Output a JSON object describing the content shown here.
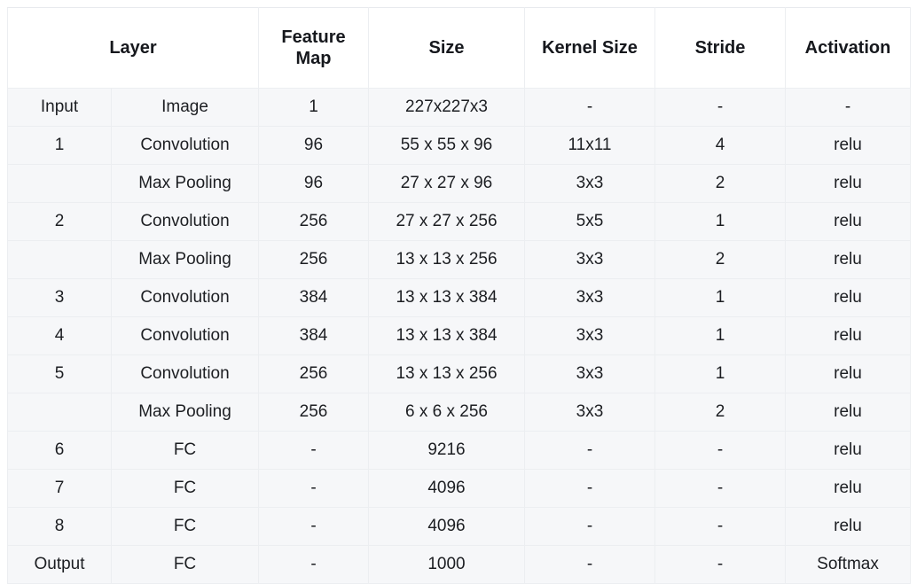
{
  "table": {
    "headers": [
      {
        "label": "Layer",
        "colspan": 2,
        "name": "header-layer"
      },
      {
        "label": "Feature Map",
        "colspan": 1,
        "name": "header-feature-map"
      },
      {
        "label": "Size",
        "colspan": 1,
        "name": "header-size"
      },
      {
        "label": "Kernel Size",
        "colspan": 1,
        "name": "header-kernel-size"
      },
      {
        "label": "Stride",
        "colspan": 1,
        "name": "header-stride"
      },
      {
        "label": "Activation",
        "colspan": 1,
        "name": "header-activation"
      }
    ],
    "column_keys": [
      "layer",
      "type",
      "feature_map",
      "size",
      "kernel_size",
      "stride",
      "activation"
    ],
    "rows": [
      {
        "layer": "Input",
        "type": "Image",
        "feature_map": "1",
        "size": "227x227x3",
        "kernel_size": "-",
        "stride": "-",
        "activation": "-"
      },
      {
        "layer": "1",
        "type": "Convolution",
        "feature_map": "96",
        "size": "55 x 55 x 96",
        "kernel_size": "11x11",
        "stride": "4",
        "activation": "relu"
      },
      {
        "layer": "",
        "type": "Max Pooling",
        "feature_map": "96",
        "size": "27 x 27 x 96",
        "kernel_size": "3x3",
        "stride": "2",
        "activation": "relu"
      },
      {
        "layer": "2",
        "type": "Convolution",
        "feature_map": "256",
        "size": "27 x 27 x 256",
        "kernel_size": "5x5",
        "stride": "1",
        "activation": "relu"
      },
      {
        "layer": "",
        "type": "Max Pooling",
        "feature_map": "256",
        "size": "13 x 13 x 256",
        "kernel_size": "3x3",
        "stride": "2",
        "activation": "relu"
      },
      {
        "layer": "3",
        "type": "Convolution",
        "feature_map": "384",
        "size": "13 x 13 x 384",
        "kernel_size": "3x3",
        "stride": "1",
        "activation": "relu"
      },
      {
        "layer": "4",
        "type": "Convolution",
        "feature_map": "384",
        "size": "13 x 13 x 384",
        "kernel_size": "3x3",
        "stride": "1",
        "activation": "relu"
      },
      {
        "layer": "5",
        "type": "Convolution",
        "feature_map": "256",
        "size": "13 x 13 x 256",
        "kernel_size": "3x3",
        "stride": "1",
        "activation": "relu"
      },
      {
        "layer": "",
        "type": "Max Pooling",
        "feature_map": "256",
        "size": "6 x 6 x 256",
        "kernel_size": "3x3",
        "stride": "2",
        "activation": "relu"
      },
      {
        "layer": "6",
        "type": "FC",
        "feature_map": "-",
        "size": "9216",
        "kernel_size": "-",
        "stride": "-",
        "activation": "relu"
      },
      {
        "layer": "7",
        "type": "FC",
        "feature_map": "-",
        "size": "4096",
        "kernel_size": "-",
        "stride": "-",
        "activation": "relu"
      },
      {
        "layer": "8",
        "type": "FC",
        "feature_map": "-",
        "size": "4096",
        "kernel_size": "-",
        "stride": "-",
        "activation": "relu"
      },
      {
        "layer": "Output",
        "type": "FC",
        "feature_map": "-",
        "size": "1000",
        "kernel_size": "-",
        "stride": "-",
        "activation": "Softmax"
      }
    ]
  },
  "style": {
    "header_background": "#ffffff",
    "row_background": "#f6f7f9",
    "border_color": "#eceef1",
    "text_color": "#1c1e22",
    "page_background": "#ffffff"
  }
}
